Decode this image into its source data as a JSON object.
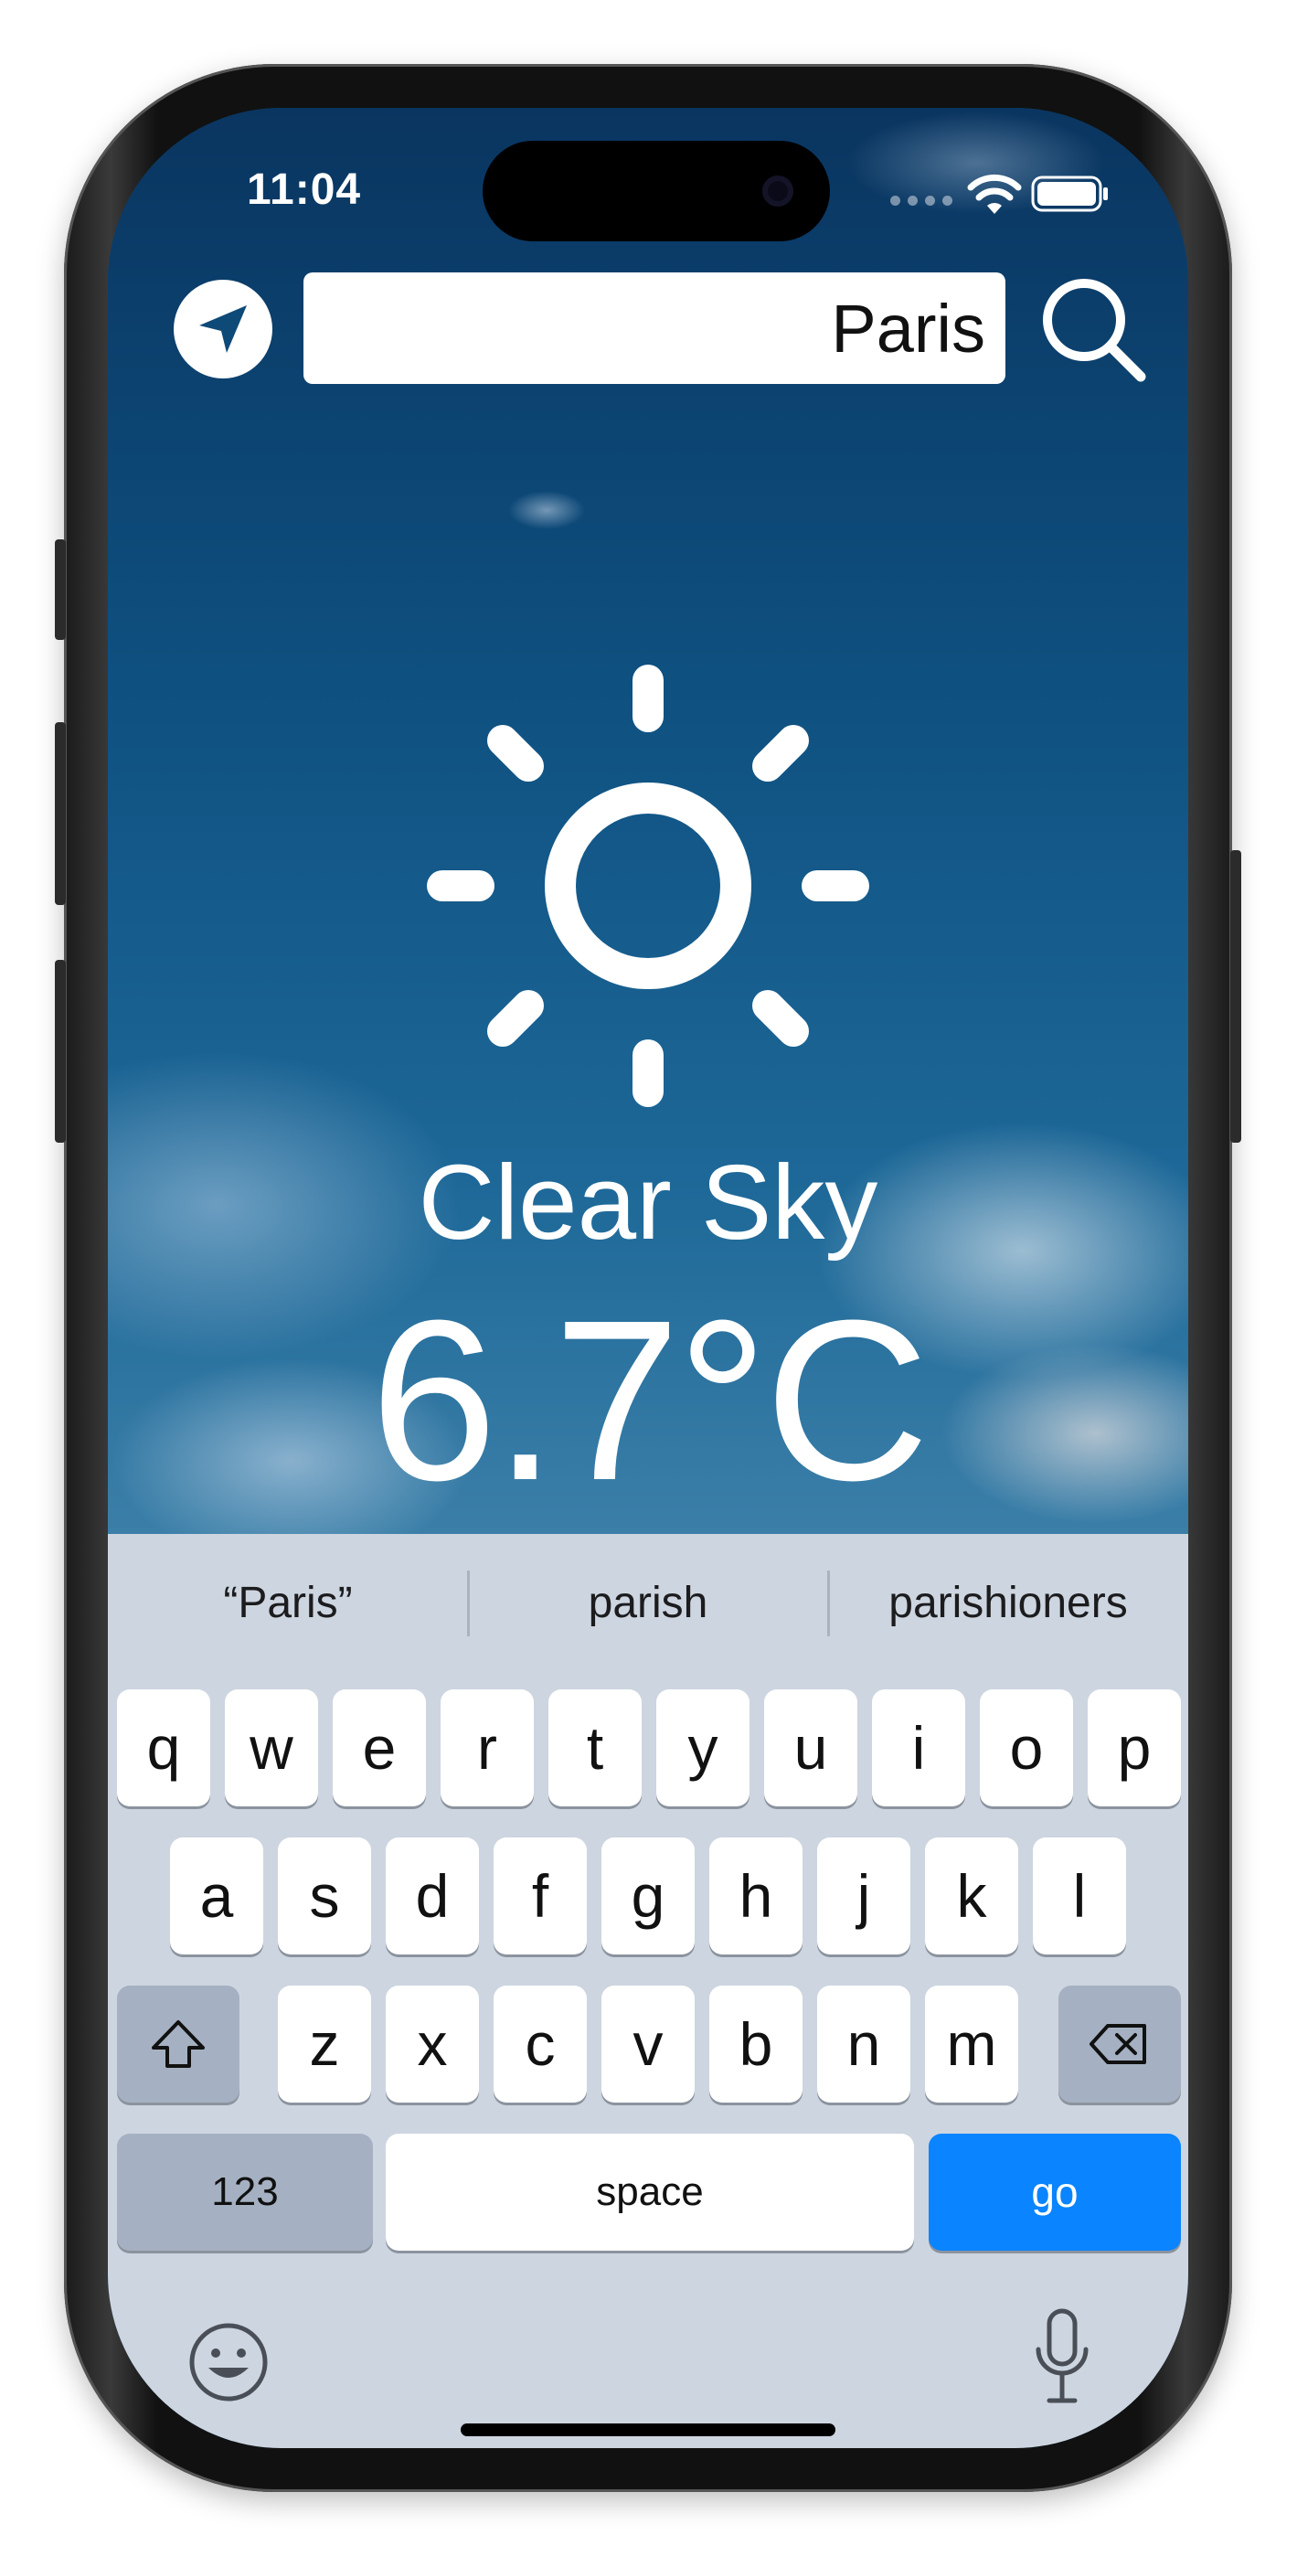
{
  "status_bar": {
    "time": "11:04"
  },
  "search": {
    "value": "Paris"
  },
  "weather": {
    "description": "Clear Sky",
    "temperature": "6.7°C",
    "icon": "sun-icon"
  },
  "keyboard": {
    "suggestions": [
      "“Paris”",
      "parish",
      "parishioners"
    ],
    "row1": [
      "q",
      "w",
      "e",
      "r",
      "t",
      "y",
      "u",
      "i",
      "o",
      "p"
    ],
    "row2": [
      "a",
      "s",
      "d",
      "f",
      "g",
      "h",
      "j",
      "k",
      "l"
    ],
    "row3": [
      "z",
      "x",
      "c",
      "v",
      "b",
      "n",
      "m"
    ],
    "numbers_label": "123",
    "space_label": "space",
    "go_label": "go"
  },
  "colors": {
    "accent": "#0a84ff",
    "keyboard_bg": "#cdd5e0",
    "sky": "#0e5080"
  }
}
